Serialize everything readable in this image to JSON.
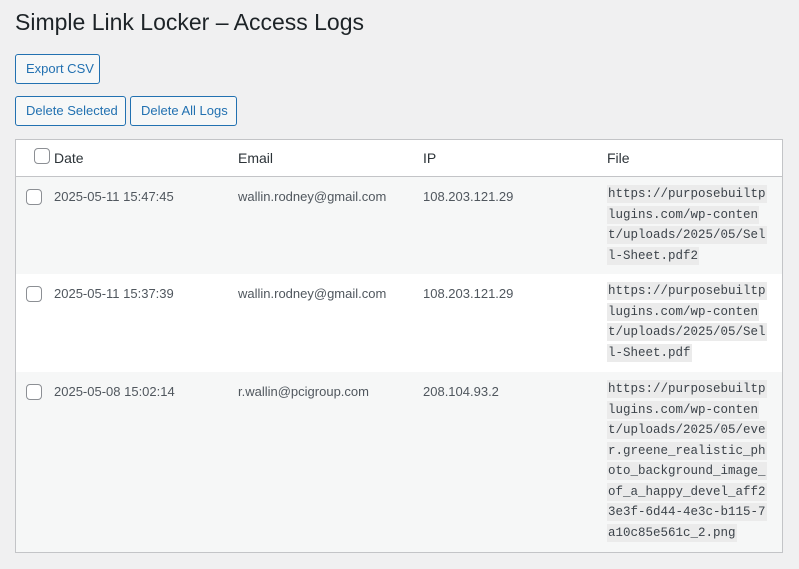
{
  "header": {
    "title": "Simple Link Locker – Access Logs"
  },
  "toolbar": {
    "export_label": "Export CSV",
    "delete_selected_label": "Delete Selected",
    "delete_all_label": "Delete All Logs"
  },
  "table": {
    "columns": [
      "Date",
      "Email",
      "IP",
      "File"
    ],
    "rows": [
      {
        "date": "2025-05-11 15:47:45",
        "email": "wallin.rodney@gmail.com",
        "ip": "108.203.121.29",
        "file": "https://purposebuiltplugins.com/wp-content/uploads/2025/05/Sell-Sheet.pdf2"
      },
      {
        "date": "2025-05-11 15:37:39",
        "email": "wallin.rodney@gmail.com",
        "ip": "108.203.121.29",
        "file": "https://purposebuiltplugins.com/wp-content/uploads/2025/05/Sell-Sheet.pdf"
      },
      {
        "date": "2025-05-08 15:02:14",
        "email": "r.wallin@pcigroup.com",
        "ip": "208.104.93.2",
        "file": "https://purposebuiltplugins.com/wp-content/uploads/2025/05/ever.greene_realistic_photo_background_image_of_a_happy_devel_aff23e3f-6d44-4e3c-b115-7a10c85e561c_2.png"
      }
    ]
  },
  "colors": {
    "accent": "#2271b1",
    "background": "#f0f0f1",
    "border": "#c3c4c7"
  }
}
